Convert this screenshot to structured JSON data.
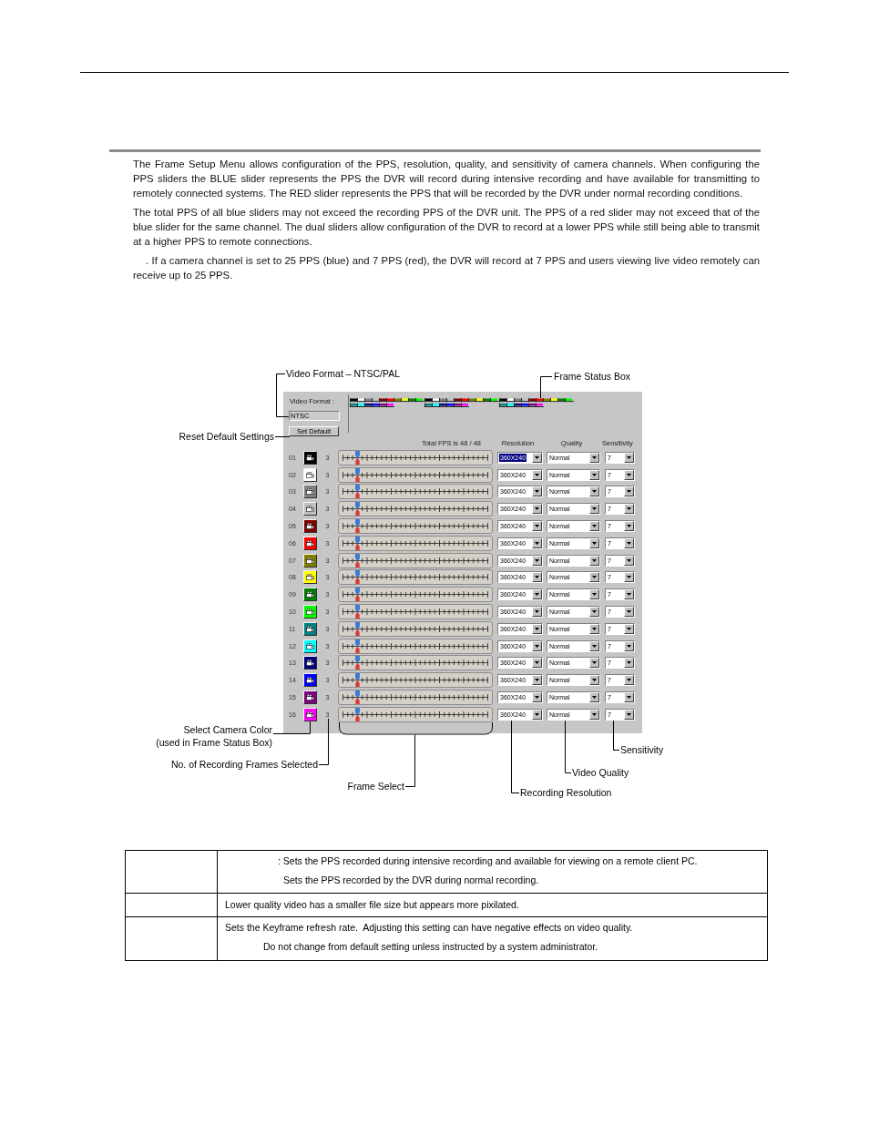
{
  "intro": {
    "paragraphs": [
      "The Frame Setup Menu allows configuration of the PPS, resolution, quality, and sensitivity of camera channels. When configuring the PPS sliders the BLUE slider represents the PPS the DVR will record during intensive recording and have available for transmitting to remotely connected systems. The RED slider represents the PPS that will be recorded by the DVR under normal recording conditions.",
      "The total PPS of all blue sliders may not exceed the recording PPS of the DVR unit. The PPS of a red slider may not exceed that of the blue slider for the same channel. The dual sliders allow configuration of the DVR to record at a lower PPS while still being able to transmit at a higher PPS to remote connections.",
      ". If a camera channel is set to 25 PPS (blue) and 7 PPS (red), the DVR will record at 7 PPS and users viewing live video remotely can receive up to 25 PPS."
    ]
  },
  "frame_setup": {
    "video_format_label": "Video Format :",
    "video_format": "NTSC",
    "set_default_button": "Set Default",
    "total_fps": "Total FPS is 48 / 48",
    "columns": [
      "Resolution",
      "Quality",
      "Sensitivity"
    ],
    "rows": [
      {
        "number": "01",
        "color": "#000000",
        "frames": "3",
        "blue_slider": {
          "level": 0.1
        },
        "red_slider": {
          "level": 0.1
        },
        "resolution": {
          "value": "360X240",
          "focused": true
        },
        "quality": "Normal",
        "sensitivity": "7"
      },
      {
        "number": "02",
        "color": "#ffffff",
        "frames": "3",
        "blue_slider": {
          "level": 0.1
        },
        "red_slider": {
          "level": 0.1
        },
        "resolution": {
          "value": "360X240",
          "focused": false
        },
        "quality": "Normal",
        "sensitivity": "7"
      },
      {
        "number": "03",
        "color": "#808080",
        "frames": "3",
        "blue_slider": {
          "level": 0.1
        },
        "red_slider": {
          "level": 0.1
        },
        "resolution": {
          "value": "360X240",
          "focused": false
        },
        "quality": "Normal",
        "sensitivity": "7"
      },
      {
        "number": "04",
        "color": "#c0c0c0",
        "frames": "3",
        "blue_slider": {
          "level": 0.1
        },
        "red_slider": {
          "level": 0.1
        },
        "resolution": {
          "value": "360X240",
          "focused": false
        },
        "quality": "Normal",
        "sensitivity": "7"
      },
      {
        "number": "05",
        "color": "#800000",
        "frames": "3",
        "blue_slider": {
          "level": 0.1
        },
        "red_slider": {
          "level": 0.1
        },
        "resolution": {
          "value": "360X240",
          "focused": false
        },
        "quality": "Normal",
        "sensitivity": "7"
      },
      {
        "number": "06",
        "color": "#ff0000",
        "frames": "3",
        "blue_slider": {
          "level": 0.1
        },
        "red_slider": {
          "level": 0.1
        },
        "resolution": {
          "value": "360X240",
          "focused": false
        },
        "quality": "Normal",
        "sensitivity": "7"
      },
      {
        "number": "07",
        "color": "#808000",
        "frames": "3",
        "blue_slider": {
          "level": 0.1
        },
        "red_slider": {
          "level": 0.1
        },
        "resolution": {
          "value": "360X240",
          "focused": false
        },
        "quality": "Normal",
        "sensitivity": "7"
      },
      {
        "number": "08",
        "color": "#ffff00",
        "frames": "3",
        "blue_slider": {
          "level": 0.1
        },
        "red_slider": {
          "level": 0.1
        },
        "resolution": {
          "value": "360X240",
          "focused": false
        },
        "quality": "Normal",
        "sensitivity": "7"
      },
      {
        "number": "09",
        "color": "#008000",
        "frames": "3",
        "blue_slider": {
          "level": 0.1
        },
        "red_slider": {
          "level": 0.1
        },
        "resolution": {
          "value": "360X240",
          "focused": false
        },
        "quality": "Normal",
        "sensitivity": "7"
      },
      {
        "number": "10",
        "color": "#00ff00",
        "frames": "3",
        "blue_slider": {
          "level": 0.1
        },
        "red_slider": {
          "level": 0.1
        },
        "resolution": {
          "value": "360X240",
          "focused": false
        },
        "quality": "Normal",
        "sensitivity": "7"
      },
      {
        "number": "11",
        "color": "#008080",
        "frames": "3",
        "blue_slider": {
          "level": 0.1
        },
        "red_slider": {
          "level": 0.1
        },
        "resolution": {
          "value": "360X240",
          "focused": false
        },
        "quality": "Normal",
        "sensitivity": "7"
      },
      {
        "number": "12",
        "color": "#00ffff",
        "frames": "3",
        "blue_slider": {
          "level": 0.1
        },
        "red_slider": {
          "level": 0.1
        },
        "resolution": {
          "value": "360X240",
          "focused": false
        },
        "quality": "Normal",
        "sensitivity": "7"
      },
      {
        "number": "13",
        "color": "#000080",
        "frames": "3",
        "blue_slider": {
          "level": 0.1
        },
        "red_slider": {
          "level": 0.1
        },
        "resolution": {
          "value": "360X240",
          "focused": false
        },
        "quality": "Normal",
        "sensitivity": "7"
      },
      {
        "number": "14",
        "color": "#0000ff",
        "frames": "3",
        "blue_slider": {
          "level": 0.1
        },
        "red_slider": {
          "level": 0.1
        },
        "resolution": {
          "value": "360X240",
          "focused": false
        },
        "quality": "Normal",
        "sensitivity": "7"
      },
      {
        "number": "15",
        "color": "#800080",
        "frames": "3",
        "blue_slider": {
          "level": 0.1
        },
        "red_slider": {
          "level": 0.1
        },
        "resolution": {
          "value": "360X240",
          "focused": false
        },
        "quality": "Normal",
        "sensitivity": "7"
      },
      {
        "number": "16",
        "color": "#ff00ff",
        "frames": "3",
        "blue_slider": {
          "level": 0.1
        },
        "red_slider": {
          "level": 0.1
        },
        "resolution": {
          "value": "360X240",
          "focused": false
        },
        "quality": "Normal",
        "sensitivity": "7"
      }
    ]
  },
  "callouts": {
    "video_format": "Video Format – NTSC/PAL",
    "frame_status_box": "Frame Status Box",
    "reset_default": "Reset Default Settings",
    "camera_color": "Select Camera Color",
    "camera_color_note": "(used in Frame Status Box)",
    "recording_frames": "No. of Recording Frames Selected",
    "frame_select": "Frame Select",
    "recording_resolution": "Recording Resolution",
    "video_quality": "Video Quality",
    "sensitivity": "Sensitivity"
  },
  "table": {
    "rows": [
      {
        "lines": [
          ": Sets the PPS recorded during intensive recording and available for viewing on a remote client PC.",
          "Sets the PPS recorded by the DVR during normal recording."
        ]
      },
      {
        "lines": [
          "Lower quality video has a smaller file size but appears more pixilated."
        ]
      },
      {
        "lines": [
          "Sets the Keyframe refresh rate.  Adjusting this setting can have negative effects on video quality.",
          "Do not change from default setting unless instructed by a system administrator."
        ]
      }
    ]
  }
}
